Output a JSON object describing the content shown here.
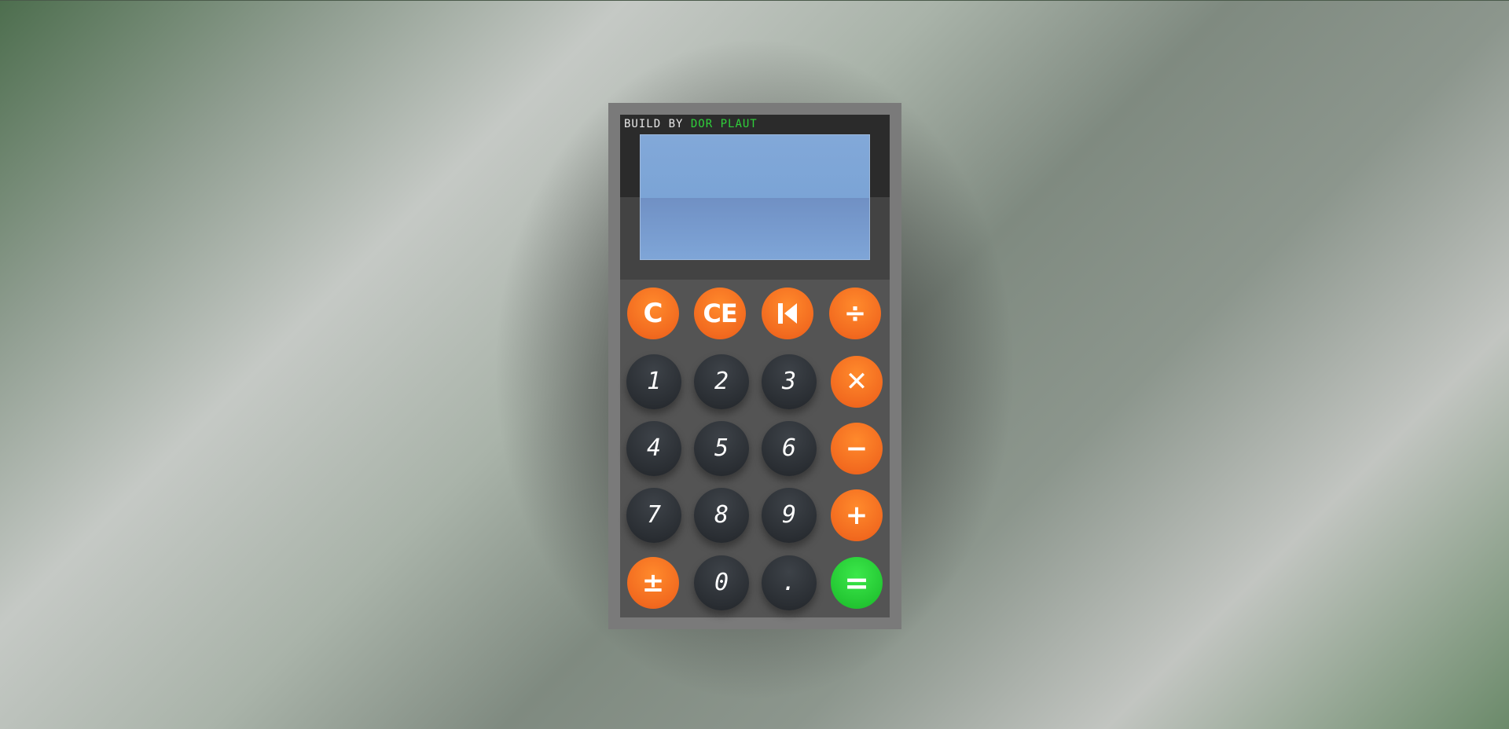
{
  "credit": {
    "prefix": "BUILD BY",
    "author": "DOR PLAUT"
  },
  "display": {
    "value": ""
  },
  "keys": {
    "clear": "C",
    "clear_entry": "CE",
    "backspace_icon": "backspace-icon",
    "divide": "÷",
    "one": "1",
    "two": "2",
    "three": "3",
    "multiply": "✕",
    "four": "4",
    "five": "5",
    "six": "6",
    "minus": "−",
    "seven": "7",
    "eight": "8",
    "nine": "9",
    "plus": "+",
    "plus_minus": "±",
    "zero": "0",
    "decimal": ".",
    "equals": "="
  },
  "colors": {
    "operator": "#f26a1f",
    "digit": "#2a2e33",
    "equals": "#22c431",
    "display": "#7ba4d6",
    "author": "#2fd03a"
  }
}
